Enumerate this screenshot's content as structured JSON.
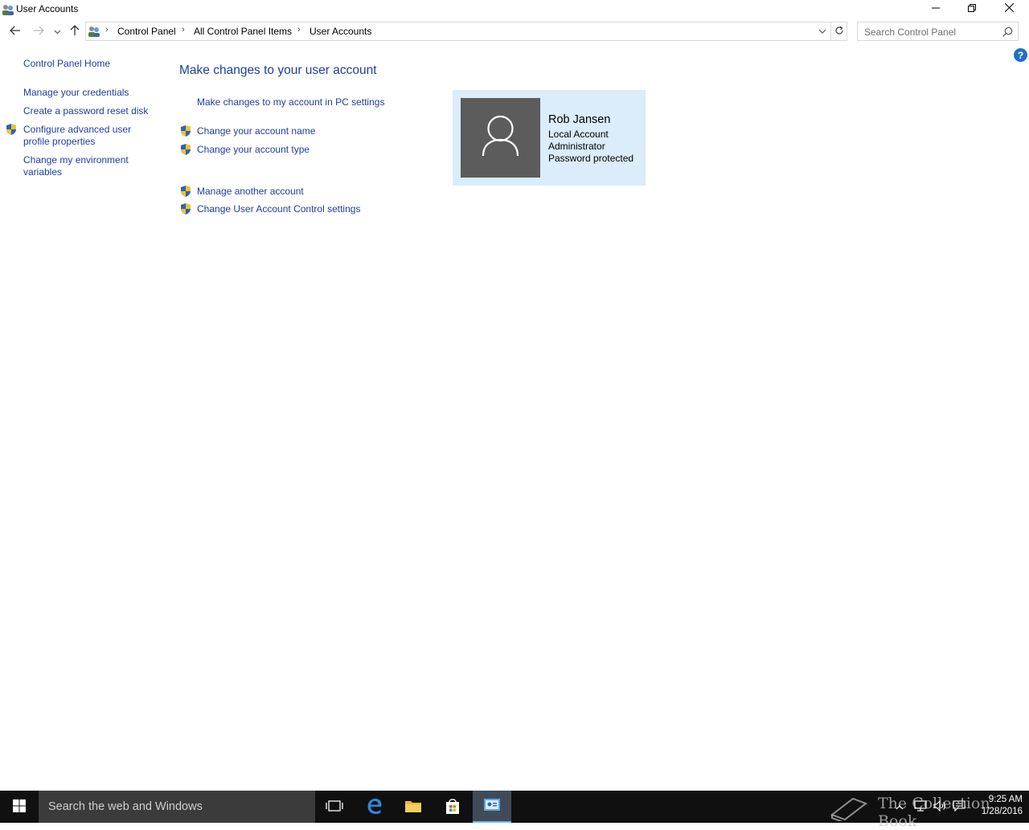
{
  "window": {
    "title": "User Accounts",
    "icons": {
      "app": "users-icon",
      "minimize": "minimize-icon",
      "maximize": "restore-icon",
      "close": "close-icon"
    }
  },
  "navigation": {
    "breadcrumbs": [
      "Control Panel",
      "All Control Panel Items",
      "User Accounts"
    ],
    "search_placeholder": "Search Control Panel"
  },
  "left_pane": {
    "home": "Control Panel Home",
    "links": [
      "Manage your credentials",
      "Create a password reset disk",
      "Configure advanced user profile properties",
      "Change my environment variables"
    ]
  },
  "main": {
    "heading": "Make changes to your user account",
    "links": [
      "Make changes to my account in PC settings",
      "Change your account name",
      "Change your account type",
      "Manage another account",
      "Change User Account Control settings"
    ]
  },
  "account": {
    "name": "Rob Jansen",
    "type": "Local Account",
    "role": "Administrator",
    "status": "Password protected"
  },
  "taskbar": {
    "search_placeholder": "Search the web and Windows",
    "time": "9:25 AM",
    "date": "1/28/2016",
    "watermark": "The Collection Book"
  },
  "colors": {
    "link": "#1e3e9e",
    "card": "#dbecfa",
    "taskbar": "#101010"
  }
}
